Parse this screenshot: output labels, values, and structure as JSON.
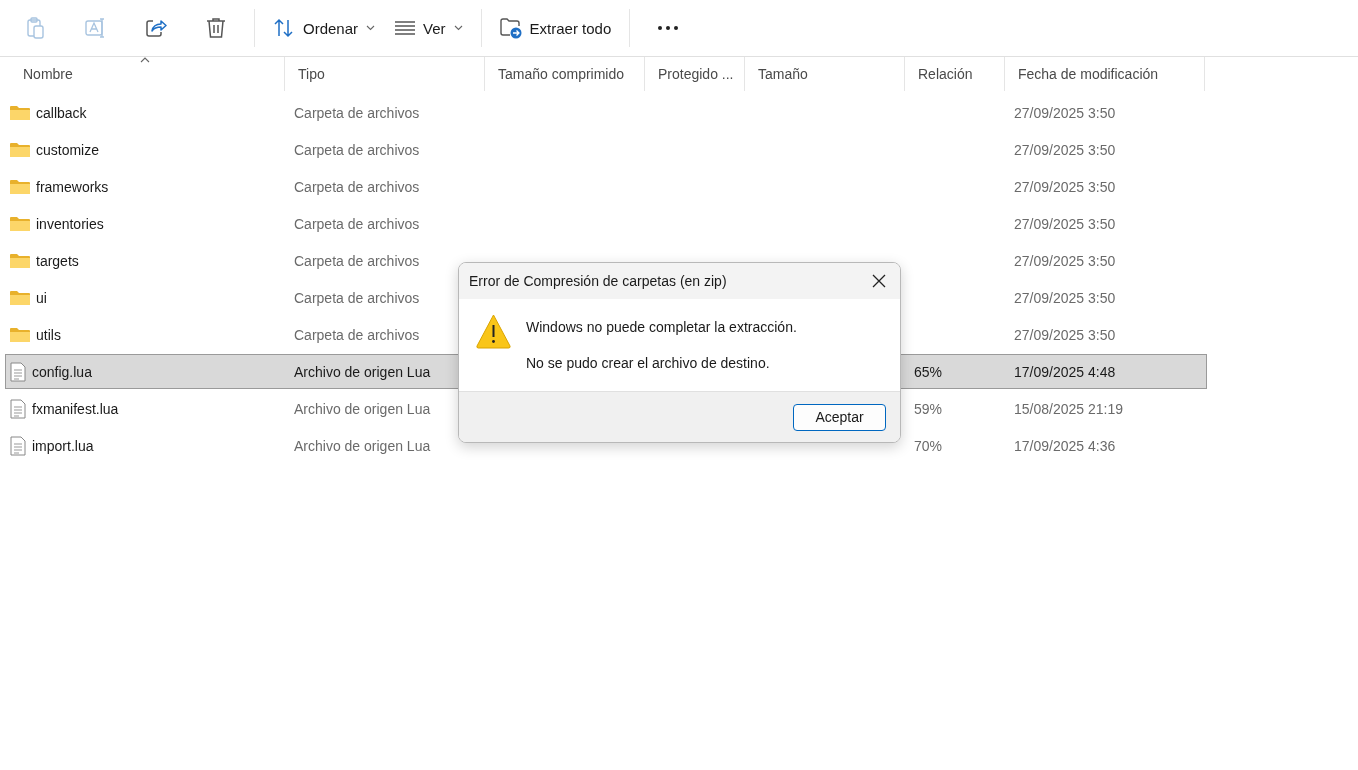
{
  "toolbar": {
    "items": [
      {
        "kind": "paste",
        "disabled": true
      },
      {
        "kind": "rename",
        "disabled": true
      },
      {
        "kind": "share",
        "disabled": false
      },
      {
        "kind": "delete",
        "disabled": false
      },
      {
        "kind": "separator"
      },
      {
        "kind": "sort",
        "label": "Ordenar",
        "dropdown": true
      },
      {
        "kind": "view",
        "label": "Ver",
        "dropdown": true
      },
      {
        "kind": "separator"
      },
      {
        "kind": "extract",
        "label": "Extraer todo"
      },
      {
        "kind": "separator"
      },
      {
        "kind": "more"
      }
    ]
  },
  "table": {
    "columns": [
      {
        "label": "Nombre",
        "sorted": true
      },
      {
        "label": "Tipo",
        "sorted": false
      },
      {
        "label": "Tamaño comprimido",
        "sorted": false
      },
      {
        "label": "Protegido ...",
        "sorted": false
      },
      {
        "label": "Tamaño",
        "sorted": false
      },
      {
        "label": "Relación",
        "sorted": false
      },
      {
        "label": "Fecha de modificación",
        "sorted": false
      }
    ],
    "rows": [
      {
        "kind": "folder",
        "name": "callback",
        "type": "Carpeta de archivos",
        "date": "27/09/2025 3:50",
        "selected": false
      },
      {
        "kind": "folder",
        "name": "customize",
        "type": "Carpeta de archivos",
        "date": "27/09/2025 3:50",
        "selected": false
      },
      {
        "kind": "folder",
        "name": "frameworks",
        "type": "Carpeta de archivos",
        "date": "27/09/2025 3:50",
        "selected": false
      },
      {
        "kind": "folder",
        "name": "inventories",
        "type": "Carpeta de archivos",
        "date": "27/09/2025 3:50",
        "selected": false
      },
      {
        "kind": "folder",
        "name": "targets",
        "type": "Carpeta de archivos",
        "date": "27/09/2025 3:50",
        "selected": false
      },
      {
        "kind": "folder",
        "name": "ui",
        "type": "Carpeta de archivos",
        "date": "27/09/2025 3:50",
        "selected": false
      },
      {
        "kind": "folder",
        "name": "utils",
        "type": "Carpeta de archivos",
        "date": "27/09/2025 3:50",
        "selected": false
      },
      {
        "kind": "file",
        "name": "config.lua",
        "type": "Archivo de origen Lua",
        "ratio": "65%",
        "date": "17/09/2025 4:48",
        "selected": true
      },
      {
        "kind": "file",
        "name": "fxmanifest.lua",
        "type": "Archivo de origen Lua",
        "ratio": "59%",
        "date": "15/08/2025 21:19",
        "selected": false
      },
      {
        "kind": "file",
        "name": "import.lua",
        "type": "Archivo de origen Lua",
        "ratio": "70%",
        "date": "17/09/2025 4:36",
        "selected": false
      }
    ]
  },
  "dialog": {
    "title": "Error de Compresión de carpetas (en zip)",
    "messages": [
      "Windows no puede completar la extracción.",
      "No se pudo crear el archivo de destino."
    ],
    "button": "Aceptar"
  }
}
